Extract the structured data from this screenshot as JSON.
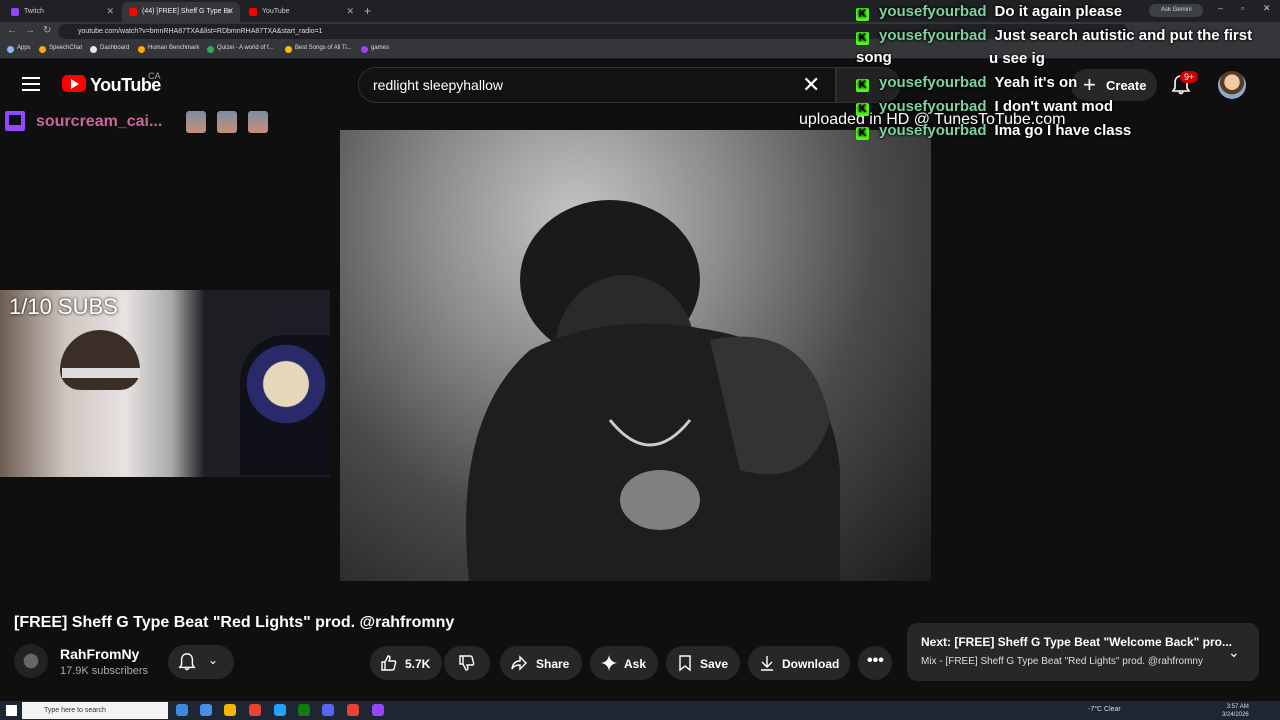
{
  "browser": {
    "tabs": [
      {
        "label": "Twitch",
        "color": "#9147ff"
      },
      {
        "label": "(44) [FREE] Sheff G Type Be",
        "color": "#ff0000"
      },
      {
        "label": "YouTube",
        "color": "#ff0000"
      }
    ],
    "ask_gemini": "Ask Gemini",
    "url": "youtube.com/watch?v=bmnRHA87TXA&list=RDbmnRHA87TXA&start_radio=1",
    "bookmarks": [
      {
        "label": "Apps",
        "color": "#8ab4f8"
      },
      {
        "label": "SpeechChat",
        "color": "#f9ab00"
      },
      {
        "label": "Dashboard",
        "color": "#e8eaed"
      },
      {
        "label": "Human Benchmark",
        "color": "#f9ab00"
      },
      {
        "label": "Quizei - A world of f...",
        "color": "#34a853"
      },
      {
        "label": "Best Songs of All Ti...",
        "color": "#fbbc04"
      },
      {
        "label": "games",
        "color": "#a142f4"
      }
    ]
  },
  "youtube": {
    "wordmark": "YouTube",
    "country": "CA",
    "search_value": "redlight sleepyhallow",
    "create_label": "Create",
    "notif_count": "9+"
  },
  "twitch": {
    "channel_name": "sourcream_cai...",
    "webcam_label": "1/10 SUBS"
  },
  "video": {
    "watermark": "uploaded in HD @ TunesToTube.com",
    "title": "[FREE] Sheff G Type Beat \"Red Lights\" prod. @rahfromny",
    "channel": "RahFromNy",
    "subscribers": "17.9K subscribers",
    "likes": "5.7K",
    "share": "Share",
    "ask": "Ask",
    "save": "Save",
    "download": "Download"
  },
  "up_next": {
    "title": "Next: [FREE] Sheff G Type Beat \"Welcome Back\" pro...",
    "subtitle": "Mix - [FREE] Sheff G Type Beat \"Red Lights\" prod. @rahfromny"
  },
  "chat": [
    {
      "user": "yousefyourbad",
      "msg": "Do it again please",
      "cont": ""
    },
    {
      "user": "yousefyourbad",
      "msg": "Just search autistic and put the first song",
      "cont": "u see ig"
    },
    {
      "user": "yousefyourbad",
      "msg": "Yeah it's on",
      "cont": ""
    },
    {
      "user": "yousefyourbad",
      "msg": "I don't want mod",
      "cont": ""
    },
    {
      "user": "yousefyourbad",
      "msg": "Ima go I have class",
      "cont": ""
    }
  ],
  "taskbar": {
    "search_placeholder": "Type here to search",
    "weather": "-7°C  Clear",
    "time": "3:57 AM",
    "date": "3/24/2026"
  }
}
